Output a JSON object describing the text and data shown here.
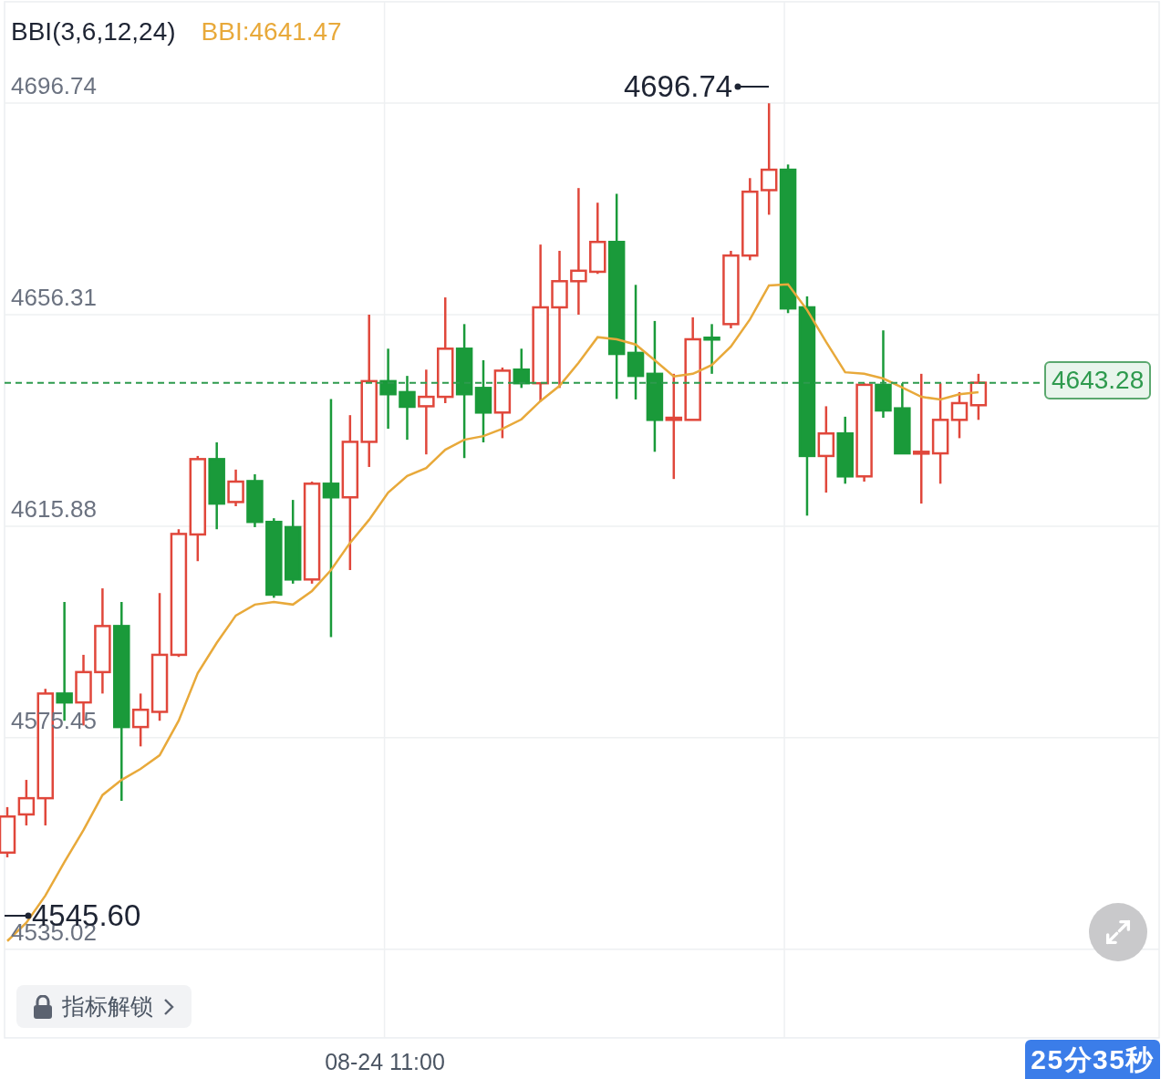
{
  "header": {
    "indicator": "BBI(3,6,12,24)",
    "value": ":4641.47"
  },
  "chart": {
    "chart_data": {
      "type": "candlestick",
      "grid": true,
      "ylim": [
        4518.1,
        4716.1
      ],
      "yticks": [
        {
          "value": 4696.74,
          "label": "4696.74"
        },
        {
          "value": 4656.31,
          "label": "4656.31"
        },
        {
          "value": 4615.88,
          "label": "4615.88"
        },
        {
          "value": 4575.45,
          "label": "4575.45"
        },
        {
          "value": 4535.02,
          "label": "4535.02"
        }
      ],
      "ohlc": [
        [
          4553.5,
          4562.2,
          4552.6,
          4560.4
        ],
        [
          4560.8,
          4567.4,
          4558.7,
          4563.9
        ],
        [
          4563.9,
          4584.8,
          4558.7,
          4583.9
        ],
        [
          4583.9,
          4601.4,
          4578.7,
          4582.2
        ],
        [
          4582.2,
          4591.3,
          4577.8,
          4588.0
        ],
        [
          4588.0,
          4604.0,
          4583.9,
          4596.8
        ],
        [
          4596.8,
          4601.4,
          4563.4,
          4577.5
        ],
        [
          4577.5,
          4583.9,
          4573.8,
          4580.8
        ],
        [
          4580.4,
          4603.1,
          4578.7,
          4591.3
        ],
        [
          4591.3,
          4615.3,
          4590.9,
          4614.4
        ],
        [
          4614.3,
          4629.3,
          4609.2,
          4628.7
        ],
        [
          4628.7,
          4631.9,
          4615.3,
          4620.2
        ],
        [
          4620.5,
          4626.7,
          4619.7,
          4624.4
        ],
        [
          4624.5,
          4625.8,
          4615.7,
          4616.7
        ],
        [
          4616.7,
          4617.4,
          4602.2,
          4602.8
        ],
        [
          4615.7,
          4620.9,
          4604.9,
          4605.7
        ],
        [
          4605.7,
          4624.4,
          4604.9,
          4624.0
        ],
        [
          4624.0,
          4640.2,
          4594.7,
          4621.4
        ],
        [
          4621.4,
          4637.1,
          4607.5,
          4632.0
        ],
        [
          4632.0,
          4656.3,
          4627.2,
          4643.6
        ],
        [
          4643.6,
          4649.8,
          4634.5,
          4641.1
        ],
        [
          4641.5,
          4644.6,
          4632.4,
          4638.7
        ],
        [
          4638.8,
          4645.8,
          4629.6,
          4640.6
        ],
        [
          4640.6,
          4659.6,
          4639.4,
          4649.8
        ],
        [
          4649.8,
          4654.5,
          4628.9,
          4641.1
        ],
        [
          4642.3,
          4647.6,
          4631.9,
          4637.6
        ],
        [
          4637.6,
          4646.2,
          4632.7,
          4645.6
        ],
        [
          4645.8,
          4649.8,
          4642.3,
          4643.2
        ],
        [
          4643.2,
          4669.7,
          4639.7,
          4657.7
        ],
        [
          4657.7,
          4668.5,
          4642.3,
          4662.7
        ],
        [
          4662.7,
          4680.5,
          4656.3,
          4664.7
        ],
        [
          4664.5,
          4677.7,
          4664.1,
          4670.2
        ],
        [
          4670.2,
          4679.4,
          4640.2,
          4648.8
        ],
        [
          4649.0,
          4662.0,
          4640.1,
          4644.6
        ],
        [
          4645.0,
          4655.1,
          4630.1,
          4636.2
        ],
        [
          4636.2,
          4645.0,
          4624.9,
          4636.6
        ],
        [
          4636.2,
          4655.8,
          4636.2,
          4651.6
        ],
        [
          4651.9,
          4654.5,
          4645.0,
          4651.6
        ],
        [
          4654.5,
          4668.5,
          4653.7,
          4667.6
        ],
        [
          4667.6,
          4682.4,
          4666.7,
          4679.8
        ],
        [
          4680.1,
          4696.7,
          4675.4,
          4684.0
        ],
        [
          4684.0,
          4685.0,
          4656.6,
          4657.5
        ],
        [
          4657.7,
          4659.8,
          4617.9,
          4629.3
        ],
        [
          4629.3,
          4638.8,
          4622.3,
          4633.6
        ],
        [
          4633.6,
          4636.8,
          4624.0,
          4625.4
        ],
        [
          4625.4,
          4643.2,
          4624.4,
          4642.9
        ],
        [
          4642.9,
          4653.3,
          4636.6,
          4638.0
        ],
        [
          4638.4,
          4643.2,
          4629.8,
          4629.8
        ],
        [
          4629.8,
          4645.0,
          4620.2,
          4630.1
        ],
        [
          4629.8,
          4643.2,
          4624.0,
          4636.2
        ],
        [
          4636.2,
          4641.5,
          4632.7,
          4639.4
        ],
        [
          4639.0,
          4645.0,
          4636.2,
          4643.3
        ]
      ],
      "series": [
        {
          "name": "BBI",
          "type": "line",
          "color": "#e8a93a",
          "values": [
            4536.6,
            4540.1,
            4545.3,
            4551.7,
            4557.8,
            4564.5,
            4567.4,
            4569.5,
            4572.1,
            4578.7,
            4587.8,
            4593.6,
            4598.8,
            4600.9,
            4601.4,
            4600.9,
            4603.5,
            4607.5,
            4612.7,
            4617.1,
            4622.3,
            4625.5,
            4627.0,
            4630.5,
            4632.4,
            4633.1,
            4634.5,
            4636.3,
            4639.8,
            4642.7,
            4647.1,
            4652.0,
            4651.6,
            4650.6,
            4647.6,
            4644.5,
            4645.0,
            4646.7,
            4650.2,
            4655.4,
            4661.9,
            4662.1,
            4657.2,
            4651.1,
            4645.3,
            4645.0,
            4644.1,
            4642.4,
            4640.6,
            4640.1,
            4641.1,
            4641.5
          ]
        }
      ],
      "annotations": [
        {
          "text": "4696.74"
        },
        {
          "text": "4545.60"
        }
      ],
      "ref_lines": [
        {
          "axis": "y",
          "value": 4643.28,
          "label": "4643.28"
        }
      ]
    },
    "time_label": "08-24 11:00"
  },
  "unlock_button": {
    "label": "指标解锁"
  },
  "countdown": "25分35秒"
}
